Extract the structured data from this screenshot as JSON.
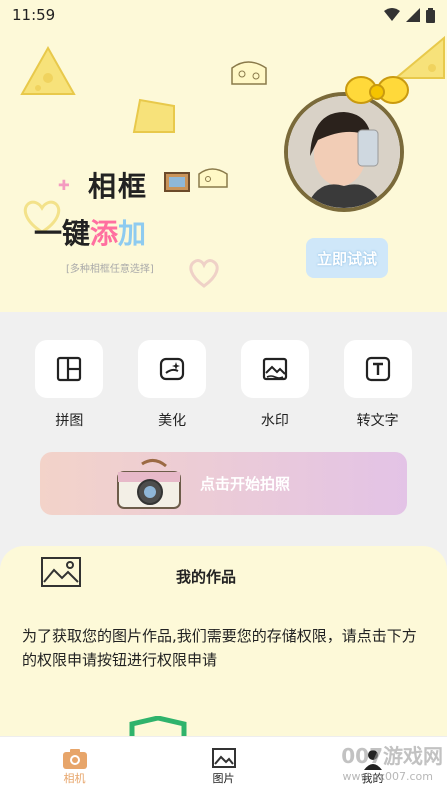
{
  "status": {
    "time": "11:59"
  },
  "banner": {
    "title_line1": "相框",
    "title_line2_a": "一键",
    "title_line2_b": "添",
    "title_line2_c": "加",
    "subtitle": "[多种相框任意选择]",
    "try_label": "立即试试"
  },
  "tools": [
    {
      "label": "拼图",
      "icon": "collage-icon"
    },
    {
      "label": "美化",
      "icon": "beautify-icon"
    },
    {
      "label": "水印",
      "icon": "watermark-icon"
    },
    {
      "label": "转文字",
      "icon": "text-icon"
    }
  ],
  "shoot": {
    "label": "点击开始拍照"
  },
  "works": {
    "title": "我的作品",
    "message": "为了获取您的图片作品,我们需要您的存储权限，请点击下方的权限申请按钮进行权限申请"
  },
  "tabs": [
    {
      "label": "相机",
      "icon": "camera-icon",
      "active": true
    },
    {
      "label": "图片",
      "icon": "image-icon",
      "active": false
    },
    {
      "label": "我的",
      "icon": "user-icon",
      "active": false
    }
  ],
  "watermark": {
    "text": "007游戏网",
    "sub": "www.yx007.com"
  },
  "colors": {
    "banner_bg": "#fdf9d8",
    "accent": "#e7a56a",
    "pink": "#ff6fa0"
  }
}
